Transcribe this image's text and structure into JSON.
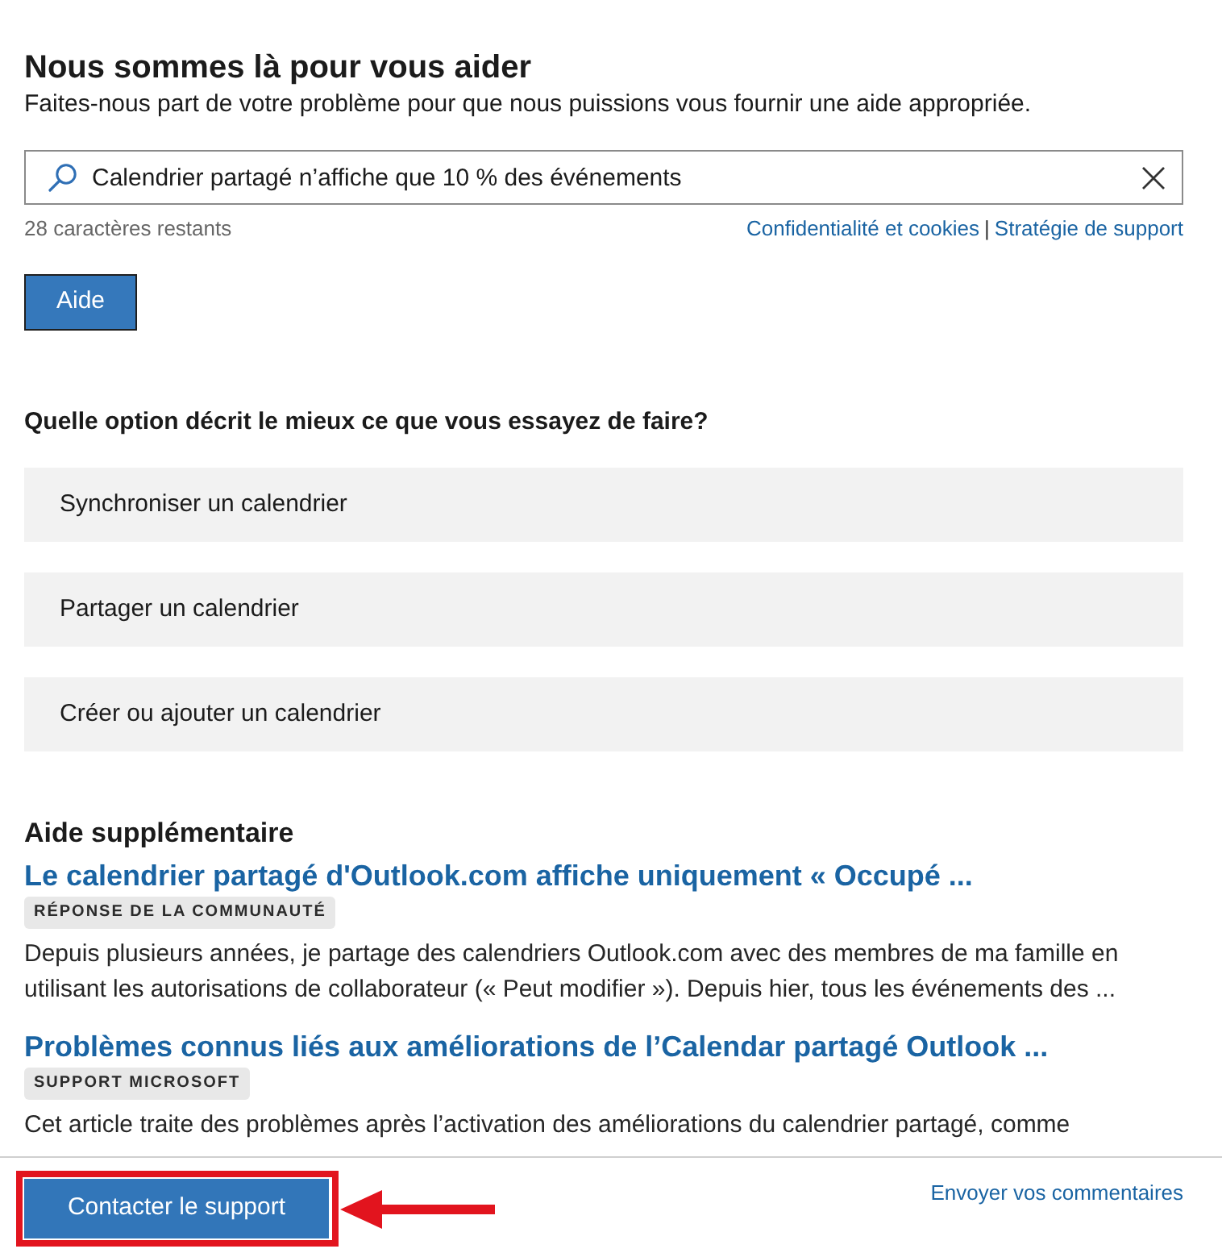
{
  "header": {
    "title": "Nous sommes là pour vous aider",
    "subtitle": "Faites-nous part de votre problème pour que nous puissions vous fournir une aide appropriée."
  },
  "search": {
    "value": "Calendrier partagé n’affiche que 10 % des événements",
    "remaining": "28 caractères restants",
    "links": [
      "Confidentialité et cookies",
      "Stratégie de support"
    ],
    "separator": "|",
    "button": "Aide"
  },
  "question": {
    "label": "Quelle option décrit le mieux ce que vous essayez de faire?",
    "options": [
      {
        "label": "Synchroniser un calendrier"
      },
      {
        "label": "Partager un calendrier"
      },
      {
        "label": "Créer ou ajouter un calendrier"
      }
    ]
  },
  "more_help": {
    "title": "Aide supplémentaire",
    "articles": [
      {
        "title": "Le calendrier partagé d'Outlook.com affiche uniquement « Occupé ...",
        "badge": "RÉPONSE DE LA COMMUNAUTÉ",
        "description": "Depuis plusieurs années, je partage des calendriers Outlook.com avec des membres de ma famille en utilisant les autorisations de collaborateur (« Peut modifier »). Depuis hier, tous les événements des ..."
      },
      {
        "title": "Problèmes connus liés aux améliorations de l’Calendar partagé Outlook ...",
        "badge": "SUPPORT MICROSOFT",
        "description": "Cet article traite des problèmes après l’activation des améliorations du calendrier partagé, comme"
      }
    ]
  },
  "footer": {
    "contact_button": "Contacter le support",
    "highlighted": true,
    "feedback_link": "Envoyer vos commentaires"
  }
}
